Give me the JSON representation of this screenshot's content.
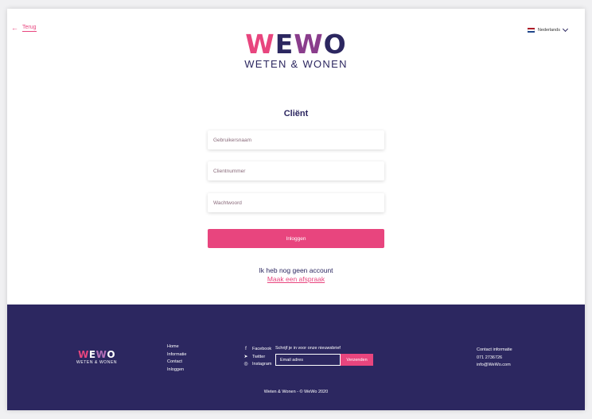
{
  "header": {
    "back_label": "Terug",
    "language": "Nederlands",
    "flag_colors": [
      "#ae1c28",
      "#ffffff",
      "#21468b"
    ]
  },
  "logo": {
    "parts": [
      "W",
      "E",
      "W",
      "O"
    ],
    "subtitle": "WETEN & WONEN"
  },
  "form": {
    "title": "Cliënt",
    "username_placeholder": "Gebruikersnaam",
    "client_number_placeholder": "Clientnummer",
    "password_placeholder": "Wachtwoord",
    "login_label": "Inloggen",
    "no_account_text": "Ik heb nog geen account",
    "appointment_link": "Maak een afspraak"
  },
  "footer": {
    "logo_parts": [
      "W",
      "E",
      "W",
      "O"
    ],
    "logo_subtitle": "WETEN & WONEN",
    "nav": [
      "Home",
      "Informatie",
      "Contact",
      "Inloggen"
    ],
    "social": [
      {
        "icon": "facebook-icon",
        "label": "Facebook"
      },
      {
        "icon": "twitter-icon",
        "label": "Twitter"
      },
      {
        "icon": "instagram-icon",
        "label": "Instagram"
      }
    ],
    "newsletter_label": "Schrijf je in voor onze nieuwsbrief",
    "email_placeholder": "Email adres",
    "send_label": "Verzenden",
    "contact_title": "Contact informatie",
    "phone": "071 2736726",
    "email": "info@WeWo.com",
    "copyright": "Weten & Wonen - © WeWo 2020"
  },
  "colors": {
    "accent": "#e8457e",
    "brand_dark": "#2c2760",
    "brand_purple": "#8a3d8c"
  }
}
